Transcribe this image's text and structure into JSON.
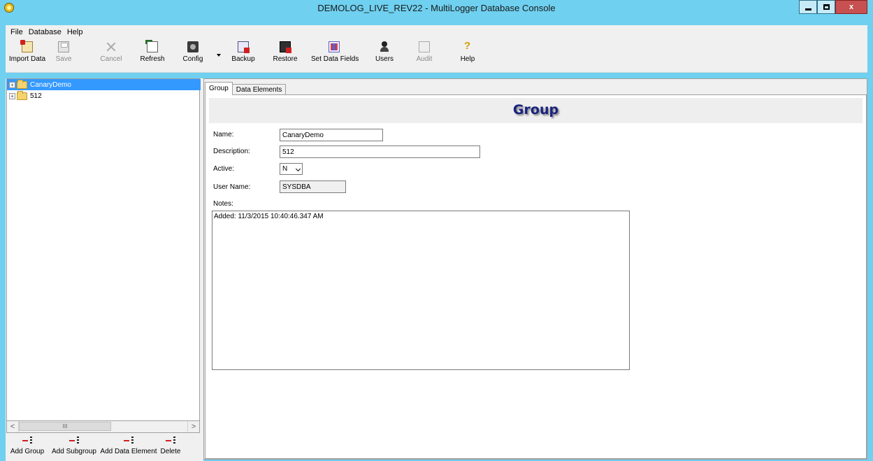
{
  "window": {
    "title": "DEMOLOG_LIVE_REV22 - MultiLogger Database Console",
    "close_glyph": "x"
  },
  "menu": {
    "items": [
      "File",
      "Database",
      "Help"
    ]
  },
  "toolbar": {
    "import_data": "Import Data",
    "save": "Save",
    "cancel": "Cancel",
    "refresh": "Refresh",
    "config": "Config",
    "backup": "Backup",
    "restore": "Restore",
    "set_data_fields": "Set Data Fields",
    "users": "Users",
    "audit": "Audit",
    "help": "Help"
  },
  "tree": {
    "nodes": [
      {
        "label": "CanaryDemo",
        "selected": true,
        "expander": "+"
      },
      {
        "label": "512",
        "selected": false,
        "expander": "+"
      }
    ]
  },
  "scrollbar": {
    "left_arrow": "<",
    "right_arrow": ">",
    "thumb_grip": "III"
  },
  "bottom_buttons": {
    "add_group": "Add Group",
    "add_subgroup": "Add Subgroup",
    "add_data_element": "Add Data Element",
    "delete": "Delete"
  },
  "tabs": [
    {
      "label": "Group",
      "active": true
    },
    {
      "label": "Data Elements",
      "active": false
    }
  ],
  "group_form": {
    "banner_title": "Group",
    "name_label": "Name:",
    "name_value": "CanaryDemo",
    "description_label": "Description:",
    "description_value": "512",
    "active_label": "Active:",
    "active_value": "N",
    "username_label": "User Name:",
    "username_value": "SYSDBA",
    "notes_label": "Notes:",
    "notes_value": "Added: 11/3/2015 10:40:46.347 AM"
  }
}
